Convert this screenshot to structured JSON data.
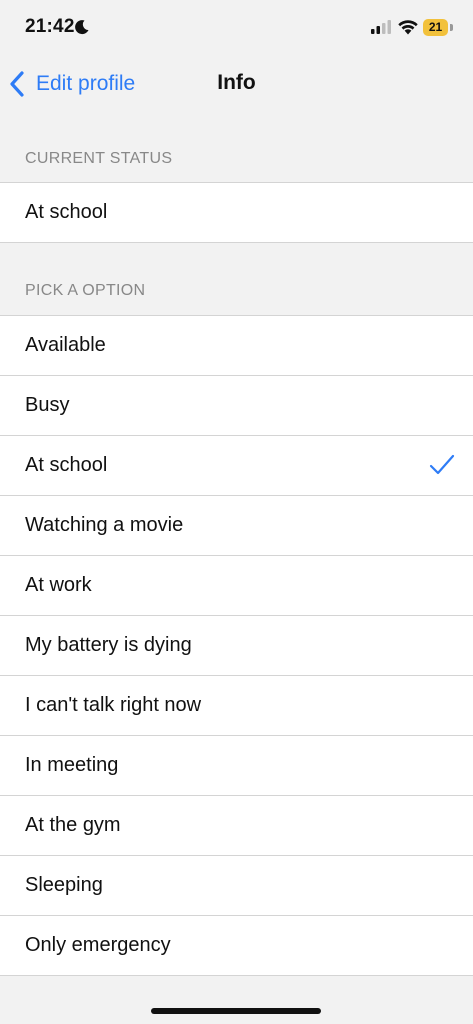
{
  "status_bar": {
    "time": "21:42",
    "battery_level": "21",
    "icons": [
      "moon-icon",
      "signal-icon",
      "wifi-icon",
      "battery-icon"
    ],
    "battery_color": "#f2c13b"
  },
  "nav": {
    "back_label": "Edit profile",
    "title": "Info",
    "accent_color": "#2e7cf6"
  },
  "current_status": {
    "header": "CURRENT STATUS",
    "value": "At school"
  },
  "options": {
    "header": "PICK A OPTION",
    "items": [
      {
        "label": "Available",
        "selected": false
      },
      {
        "label": "Busy",
        "selected": false
      },
      {
        "label": "At school",
        "selected": true
      },
      {
        "label": "Watching a movie",
        "selected": false
      },
      {
        "label": "At work",
        "selected": false
      },
      {
        "label": "My battery is dying",
        "selected": false
      },
      {
        "label": "I can't talk right now",
        "selected": false
      },
      {
        "label": "In meeting",
        "selected": false
      },
      {
        "label": "At the gym",
        "selected": false
      },
      {
        "label": "Sleeping",
        "selected": false
      },
      {
        "label": "Only emergency",
        "selected": false
      }
    ]
  }
}
